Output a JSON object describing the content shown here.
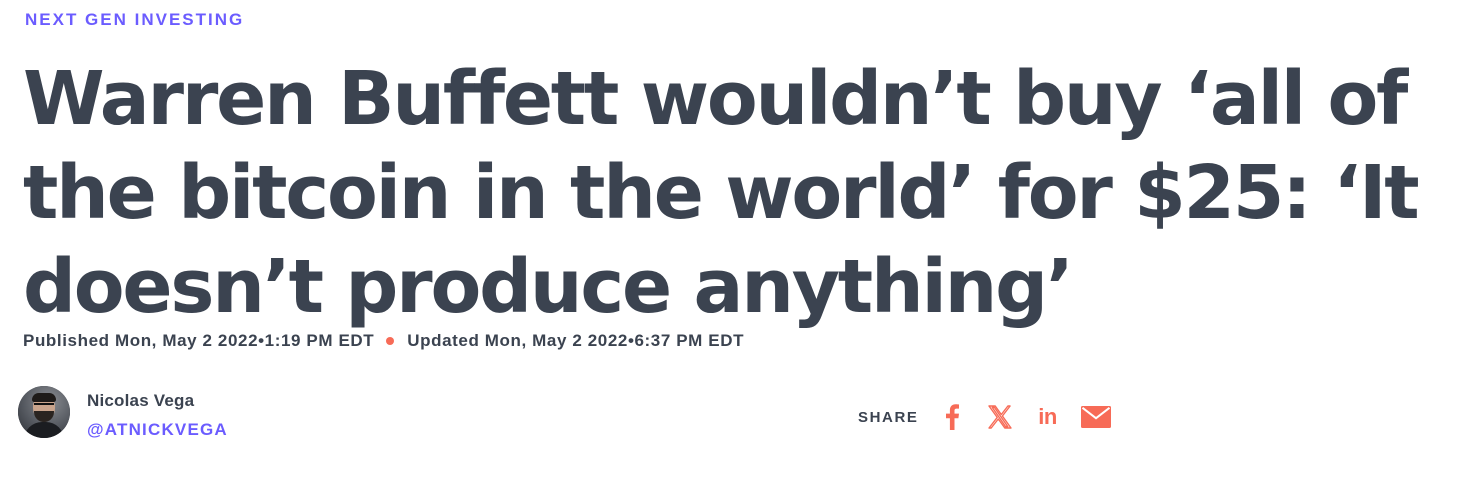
{
  "kicker": "NEXT GEN INVESTING",
  "headline": "Warren Buffett wouldn’t buy ‘all of the bitcoin in the world’ for $25: ‘It doesn’t produce anything’",
  "timestamps": {
    "published": "Published Mon, May 2 2022•1:19 PM EDT",
    "updated": "Updated Mon, May 2 2022•6:37 PM EDT"
  },
  "author": {
    "name": "Nicolas Vega",
    "handle": "@ATNICKVEGA"
  },
  "share": {
    "label": "SHARE",
    "buttons": [
      {
        "icon": "facebook-icon"
      },
      {
        "icon": "x-icon"
      },
      {
        "icon": "linkedin-icon",
        "text": "in"
      },
      {
        "icon": "email-icon"
      }
    ]
  },
  "colors": {
    "accent": "#6b5cff",
    "text": "#3b4350",
    "share_icon": "#f76b57",
    "separator_dot": "#f76b57"
  }
}
